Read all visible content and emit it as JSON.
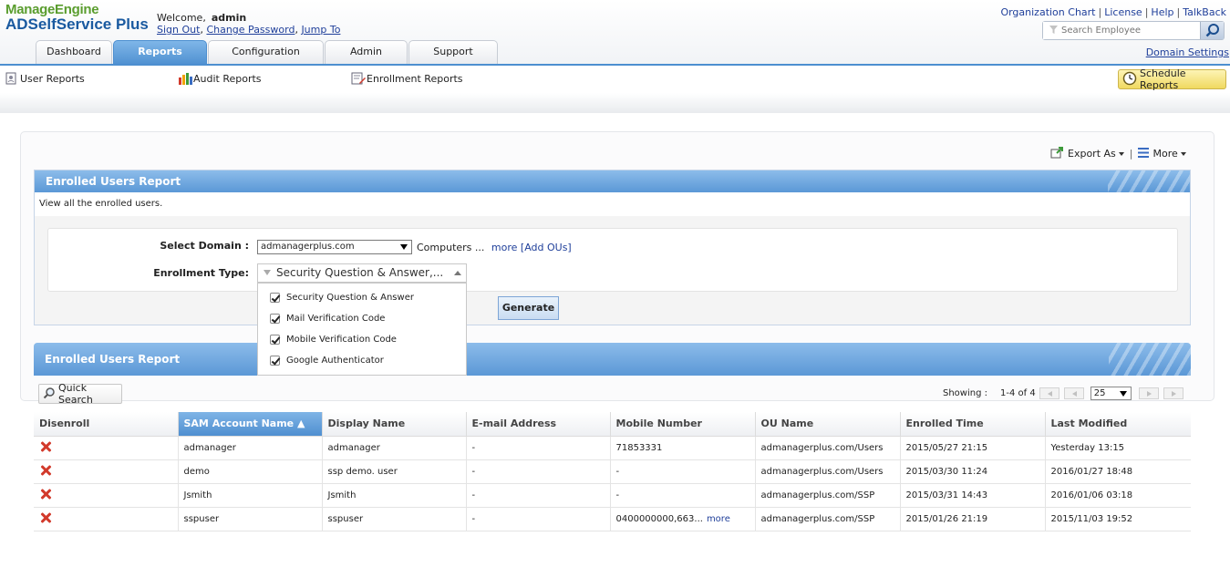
{
  "logo": {
    "brand": "ManageEngine",
    "product": "ADSelfService Plus"
  },
  "welcome": {
    "prefix": "Welcome,",
    "user": "admin",
    "sign_out": "Sign Out",
    "change_password": "Change Password",
    "jump_to": "Jump To"
  },
  "top_links": [
    "Organization Chart",
    "License",
    "Help",
    "TalkBack"
  ],
  "search": {
    "placeholder": "Search Employee"
  },
  "domain_settings": "Domain Settings",
  "tabs": [
    "Dashboard",
    "Reports",
    "Configuration",
    "Admin",
    "Support"
  ],
  "active_tab": "Reports",
  "subnav": [
    "User Reports",
    "Audit Reports",
    "Enrollment Reports"
  ],
  "schedule_reports": "Schedule Reports",
  "export": {
    "export_as": "Export As",
    "more": "More"
  },
  "filter_panel": {
    "title": "Enrolled Users Report",
    "description": "View all the enrolled users.",
    "select_domain_label": "Select Domain :",
    "domain_value": "admanagerplus.com",
    "computers": "Computers ...",
    "more": "more",
    "add_ous": "[Add OUs]",
    "enrollment_type_label": "Enrollment Type:",
    "enrollment_type_value": "Security Question & Answer,...",
    "enrollment_options": [
      "Security Question & Answer",
      "Mail Verification Code",
      "Mobile Verification Code",
      "Google Authenticator"
    ],
    "generate": "Generate"
  },
  "report": {
    "title": "Enrolled Users Report",
    "quick_search": "Quick Search",
    "showing_label": "Showing :",
    "showing_range": "1-4 of 4",
    "page_size": "25",
    "columns": [
      "Disenroll",
      "SAM Account Name ▲",
      "Display Name",
      "E-mail Address",
      "Mobile Number",
      "OU Name",
      "Enrolled Time",
      "Last Modified"
    ],
    "rows": [
      {
        "sam": "admanager",
        "display": "admanager",
        "email": "-",
        "mobile": "71853331",
        "mobile_more": "",
        "ou": "admanagerplus.com/Users",
        "enrolled": "2015/05/27 21:15",
        "modified": "Yesterday 13:15"
      },
      {
        "sam": "demo",
        "display": "ssp demo. user",
        "email": "-",
        "mobile": "-",
        "mobile_more": "",
        "ou": "admanagerplus.com/Users",
        "enrolled": "2015/03/30 11:24",
        "modified": "2016/01/27 18:48"
      },
      {
        "sam": "Jsmith",
        "display": "Jsmith",
        "email": "-",
        "mobile": "-",
        "mobile_more": "",
        "ou": "admanagerplus.com/SSP",
        "enrolled": "2015/03/31 14:43",
        "modified": "2016/01/06 03:18"
      },
      {
        "sam": "sspuser",
        "display": "sspuser",
        "email": "-",
        "mobile": "0400000000,663...",
        "mobile_more": "more",
        "ou": "admanagerplus.com/SSP",
        "enrolled": "2015/01/26 21:19",
        "modified": "2015/11/03 19:52"
      }
    ]
  },
  "colors": {
    "accent_blue": "#4d8fd0",
    "delete_red": "#d23a2b",
    "schedule_yellow": "#f0d960"
  },
  "icons": [
    "search-icon",
    "user-report-icon",
    "audit-chart-icon",
    "enrollment-report-icon",
    "clock-icon",
    "export-icon",
    "menu-icon",
    "funnel-icon",
    "magnifier-icon",
    "delete-x-icon"
  ]
}
